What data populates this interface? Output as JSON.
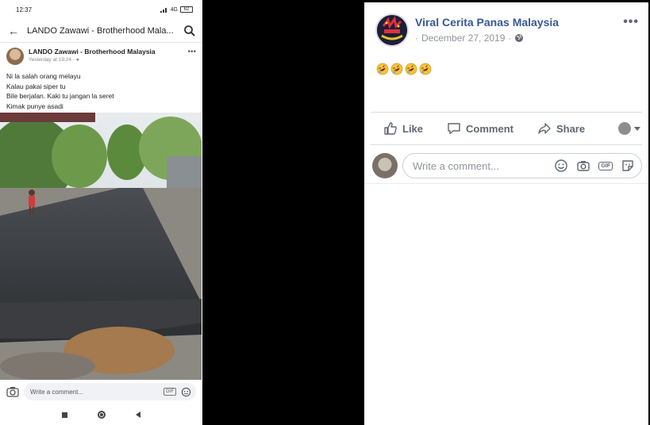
{
  "phone": {
    "status_time": "12:37",
    "status_network": "4G",
    "battery_level": "62",
    "appbar_title": "LANDO Zawawi - Brotherhood Mala...",
    "post": {
      "author": "LANDO Zawawi - Brotherhood Malaysia",
      "time": "Yesterday at 19:24 ·",
      "text_lines": [
        "Ni la salah orang melayu",
        "Kalau pakai siper  tu",
        "Bile berjalan. Kaki tu jangan la seret",
        "Kimak punye asadi"
      ]
    },
    "comment_placeholder": "Write a comment...",
    "gif_label": "GIF"
  },
  "fb_post": {
    "page_name": "Viral Cerita Panas Malaysia",
    "date": "December 27, 2019",
    "date_prefix": "·",
    "more_label": "•••",
    "emoji_count": 4,
    "actions": {
      "like": "Like",
      "comment": "Comment",
      "share": "Share"
    },
    "comment_placeholder": "Write a comment...",
    "gif_label": "GIF"
  },
  "colors": {
    "page_name": "#385898",
    "meta_gray": "#90949c",
    "action_gray": "#606770"
  },
  "icons": {
    "back": "arrow-left-icon",
    "search": "search-icon",
    "globe": "globe-icon",
    "like": "thumbs-up-icon",
    "comment": "speech-bubble-icon",
    "share": "share-arrow-icon",
    "camera": "camera-icon",
    "smile": "smiley-icon",
    "sticker": "sticker-icon",
    "emoji": "rolling-laughing-emoji-icon"
  }
}
